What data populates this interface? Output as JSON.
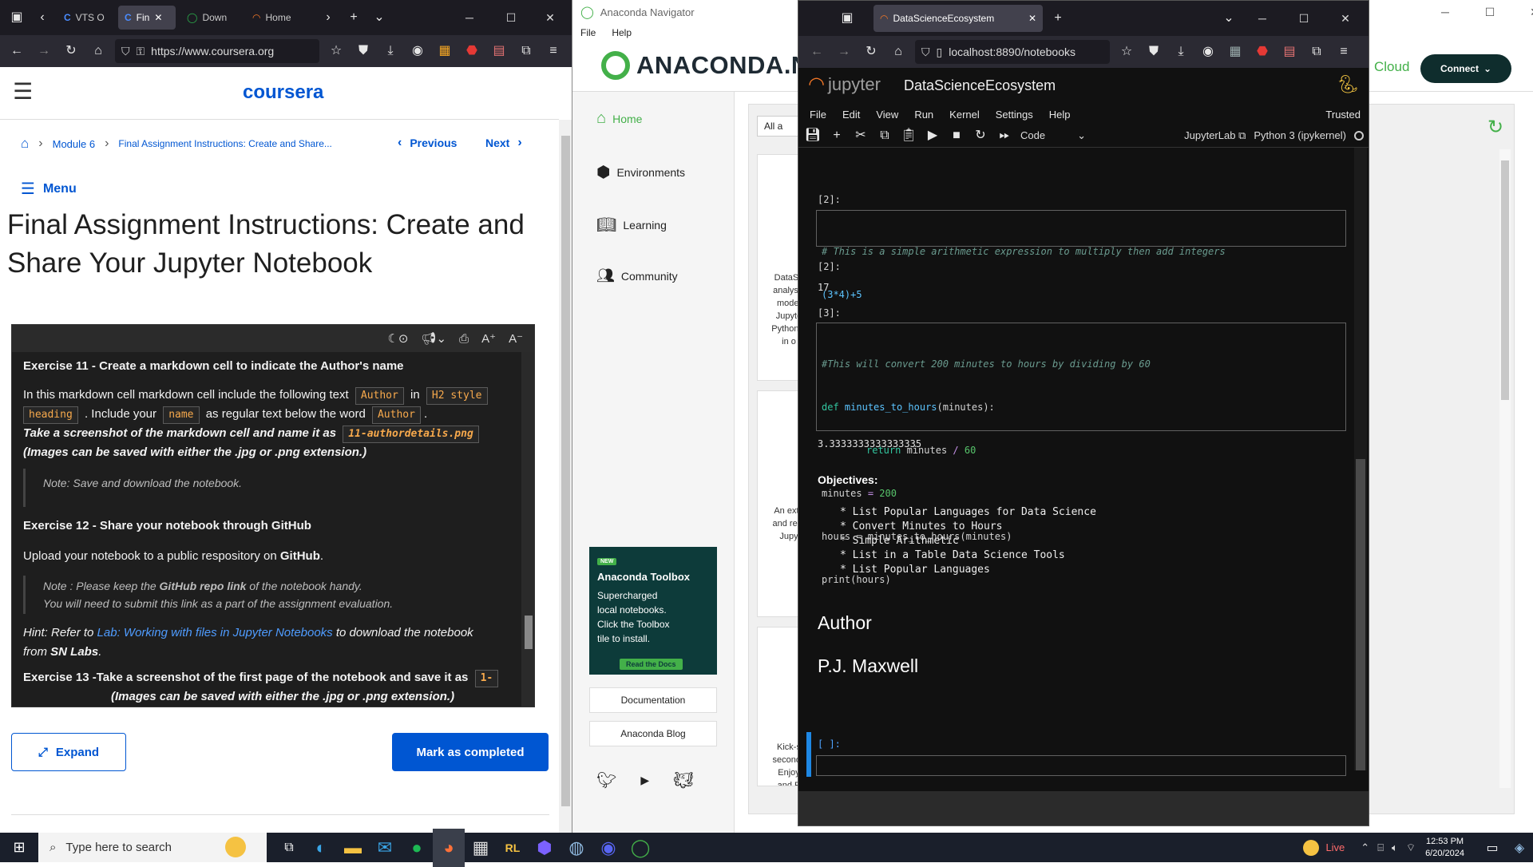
{
  "left_browser": {
    "tabs": [
      {
        "label": "VTS O",
        "icon": "coursera-icon",
        "active": false
      },
      {
        "label": "Fin",
        "icon": "coursera-icon",
        "active": true
      },
      {
        "label": "Down",
        "icon": "download-icon",
        "active": false
      },
      {
        "label": "Home",
        "icon": "jupyter-icon",
        "active": false
      }
    ],
    "url": "https://www.coursera.org"
  },
  "coursera": {
    "logo": "coursera",
    "breadcrumb": {
      "module": "Module 6",
      "current": "Final Assignment Instructions: Create and Share..."
    },
    "prev_label": "Previous",
    "next_label": "Next",
    "menu_label": "Menu",
    "page_title_line1": "Final Assignment Instructions: Create and",
    "page_title_line2": "Share Your Jupyter Notebook",
    "ex11_title": "Exercise 11 - Create a markdown cell to indicate the Author's name",
    "ex11_p1_a": "In this markdown cell markdown cell include the following text",
    "ex11_chip_author": "Author",
    "ex11_in": "in",
    "ex11_chip_h2a": "H2 style",
    "ex11_chip_h2b": "heading",
    "ex11_p1_b": ". Include your",
    "ex11_chip_name": "name",
    "ex11_p1_c": "as regular text below the word",
    "ex11_chip_author2": "Author",
    "ex11_p1_d": ".",
    "ex11_shot": "Take a screenshot of the markdown cell and name it as",
    "ex11_chip_file": "11-authordetails.png",
    "ex11_img": "(Images can be saved with either the .jpg or .png extension.)",
    "ex11_note": "Note: Save and download the notebook.",
    "ex12_title": "Exercise 12 - Share your notebook through GitHub",
    "ex12_p1_a": "Upload your notebook to a public respository on",
    "ex12_p1_b": "GitHub",
    "ex12_p1_c": ".",
    "ex12_note1_a": "Note : Please keep the",
    "ex12_note1_b": "GitHub repo link",
    "ex12_note1_c": "of the notebook handy.",
    "ex12_note2": "You will need to submit this link as a part of the assignment evaluation.",
    "hint_a": "Hint: Refer to",
    "hint_link": "Lab: Working with files in Jupyter Notebooks",
    "hint_b": "to download the notebook",
    "hint_c": "from",
    "hint_d": "SN Labs",
    "hint_e": ".",
    "ex13_title": "Exercise 13 -Take a screenshot of the first page of the notebook and save it as",
    "ex13_chip": "1-",
    "ex13_cut": "(Images can be saved with either the .jpg or .png extension.)",
    "expand_label": "Expand",
    "mark_label": "Mark as completed"
  },
  "anaconda": {
    "window_title": "Anaconda Navigator",
    "menu": [
      "File",
      "Help"
    ],
    "logo": "ANACONDA.NA",
    "nav": [
      {
        "label": "Home",
        "icon": "home-icon"
      },
      {
        "label": "Environments",
        "icon": "cube-icon"
      },
      {
        "label": "Learning",
        "icon": "book-icon"
      },
      {
        "label": "Community",
        "icon": "people-icon"
      }
    ],
    "filter_label": "All a",
    "card1_lines": [
      "DataSp",
      "analysis",
      "model",
      "Jupyte",
      "Python a",
      "in o"
    ],
    "card2_lines": [
      "An exte",
      "and repr",
      "Jupy"
    ],
    "card3_lines": [
      "Kick-s",
      "seconds",
      "Enjoy",
      "and P"
    ],
    "promo_badge": "NEW",
    "promo_title": "Anaconda Toolbox",
    "promo_text": [
      "Supercharged",
      "local notebooks.",
      "Click the Toolbox",
      "tile to install."
    ],
    "promo_btn": "Read the Docs",
    "doc_btn": "Documentation",
    "blog_btn": "Anaconda Blog",
    "cloud_label": "Cloud",
    "connect_label": "Connect"
  },
  "jupyter_browser": {
    "tab_title": "DataScienceEcosystem",
    "url": "localhost:8890/notebooks",
    "app_name": "jupyter",
    "notebook_name": "DataScienceEcosystem",
    "menu": [
      "File",
      "Edit",
      "View",
      "Run",
      "Kernel",
      "Settings",
      "Help"
    ],
    "trusted": "Trusted",
    "cell_type": "Code",
    "jupyterlab_label": "JupyterLab",
    "kernel_label": "Python 3 (ipykernel)",
    "in2_label": "[2]:",
    "in2_comment": "# This is a simple arithmetic expression to multiply then add integers",
    "in2_code": "(3*4)+5",
    "out2_label": "[2]:",
    "out2_value": "17",
    "in3_label": "[3]:",
    "in3_comment": "#This will convert 200 minutes to hours by dividing by 60",
    "in3_l2_kw": "def",
    "in3_l2_fn": "minutes_to_hours",
    "in3_l2_rest": "(minutes):",
    "in3_l3_kw": "return",
    "in3_l3_rest": "minutes",
    "in3_l3_op": "/",
    "in3_l3_num": "60",
    "in3_l4_a": "minutes",
    "in3_l4_op": "=",
    "in3_l4_num": "200",
    "in3_l5": "hours = minutes_to_hours(minutes)",
    "in3_l6": "print(hours)",
    "out3_value": "3.3333333333333335",
    "objectives_title": "Objectives:",
    "objectives": [
      "* List Popular Languages for Data Science",
      "* Convert Minutes to Hours",
      "* Simple Arithmetic",
      "* List in a Table Data Science Tools",
      "* List Popular Languages"
    ],
    "author_heading": "Author",
    "author_name": "P.J. Maxwell",
    "empty_prompt": "[ ]:"
  },
  "taskbar": {
    "search_placeholder": "Type here to search",
    "live_label": "Live",
    "time": "12:53 PM",
    "date": "6/20/2024"
  }
}
